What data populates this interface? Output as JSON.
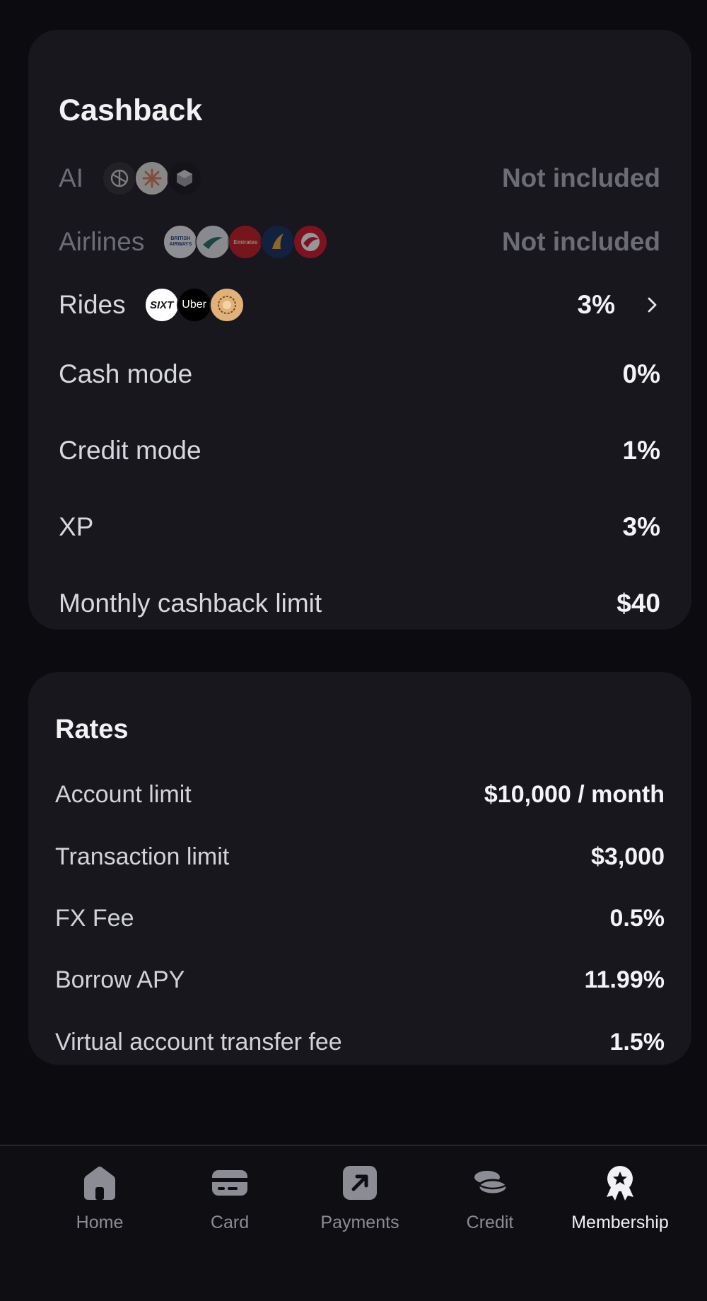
{
  "cashback": {
    "title": "Cashback",
    "rows": [
      {
        "label": "AI",
        "value": "Not included",
        "logos": [
          "openai-logo",
          "claude-logo",
          "perplexity-logo"
        ]
      },
      {
        "label": "Airlines",
        "value": "Not included",
        "logos": [
          "british-airways-logo",
          "cathay-pacific-logo",
          "emirates-logo",
          "singapore-airlines-logo",
          "turkish-airlines-logo"
        ]
      },
      {
        "label": "Rides",
        "value": "3%",
        "logos": [
          "sixt-logo",
          "uber-logo",
          "bolt-logo"
        ]
      },
      {
        "label": "Cash mode",
        "value": "0%"
      },
      {
        "label": "Credit mode",
        "value": "1%"
      },
      {
        "label": "XP",
        "value": "3%"
      },
      {
        "label": "Monthly cashback limit",
        "value": "$40"
      }
    ],
    "logo_text": {
      "sixt": "SIXT",
      "uber": "Uber",
      "british_airways": "BRITISH AIRWAYS",
      "emirates": "Emirates"
    }
  },
  "rates": {
    "title": "Rates",
    "rows": [
      {
        "label": "Account limit",
        "value": "$10,000 / month"
      },
      {
        "label": "Transaction limit",
        "value": "$3,000"
      },
      {
        "label": "FX Fee",
        "value": "0.5%"
      },
      {
        "label": "Borrow APY",
        "value": "11.99%"
      },
      {
        "label": "Virtual account transfer fee",
        "value": "1.5%"
      }
    ]
  },
  "nav": {
    "items": [
      {
        "label": "Home",
        "icon": "home-icon"
      },
      {
        "label": "Card",
        "icon": "card-icon"
      },
      {
        "label": "Payments",
        "icon": "payments-icon"
      },
      {
        "label": "Credit",
        "icon": "coins-icon"
      },
      {
        "label": "Membership",
        "icon": "membership-badge-icon"
      }
    ],
    "active": "Membership"
  },
  "colors": {
    "background": "#0b0b10",
    "card": "#17171d",
    "text": "#f2f2f5",
    "muted": "#6c6c75"
  }
}
